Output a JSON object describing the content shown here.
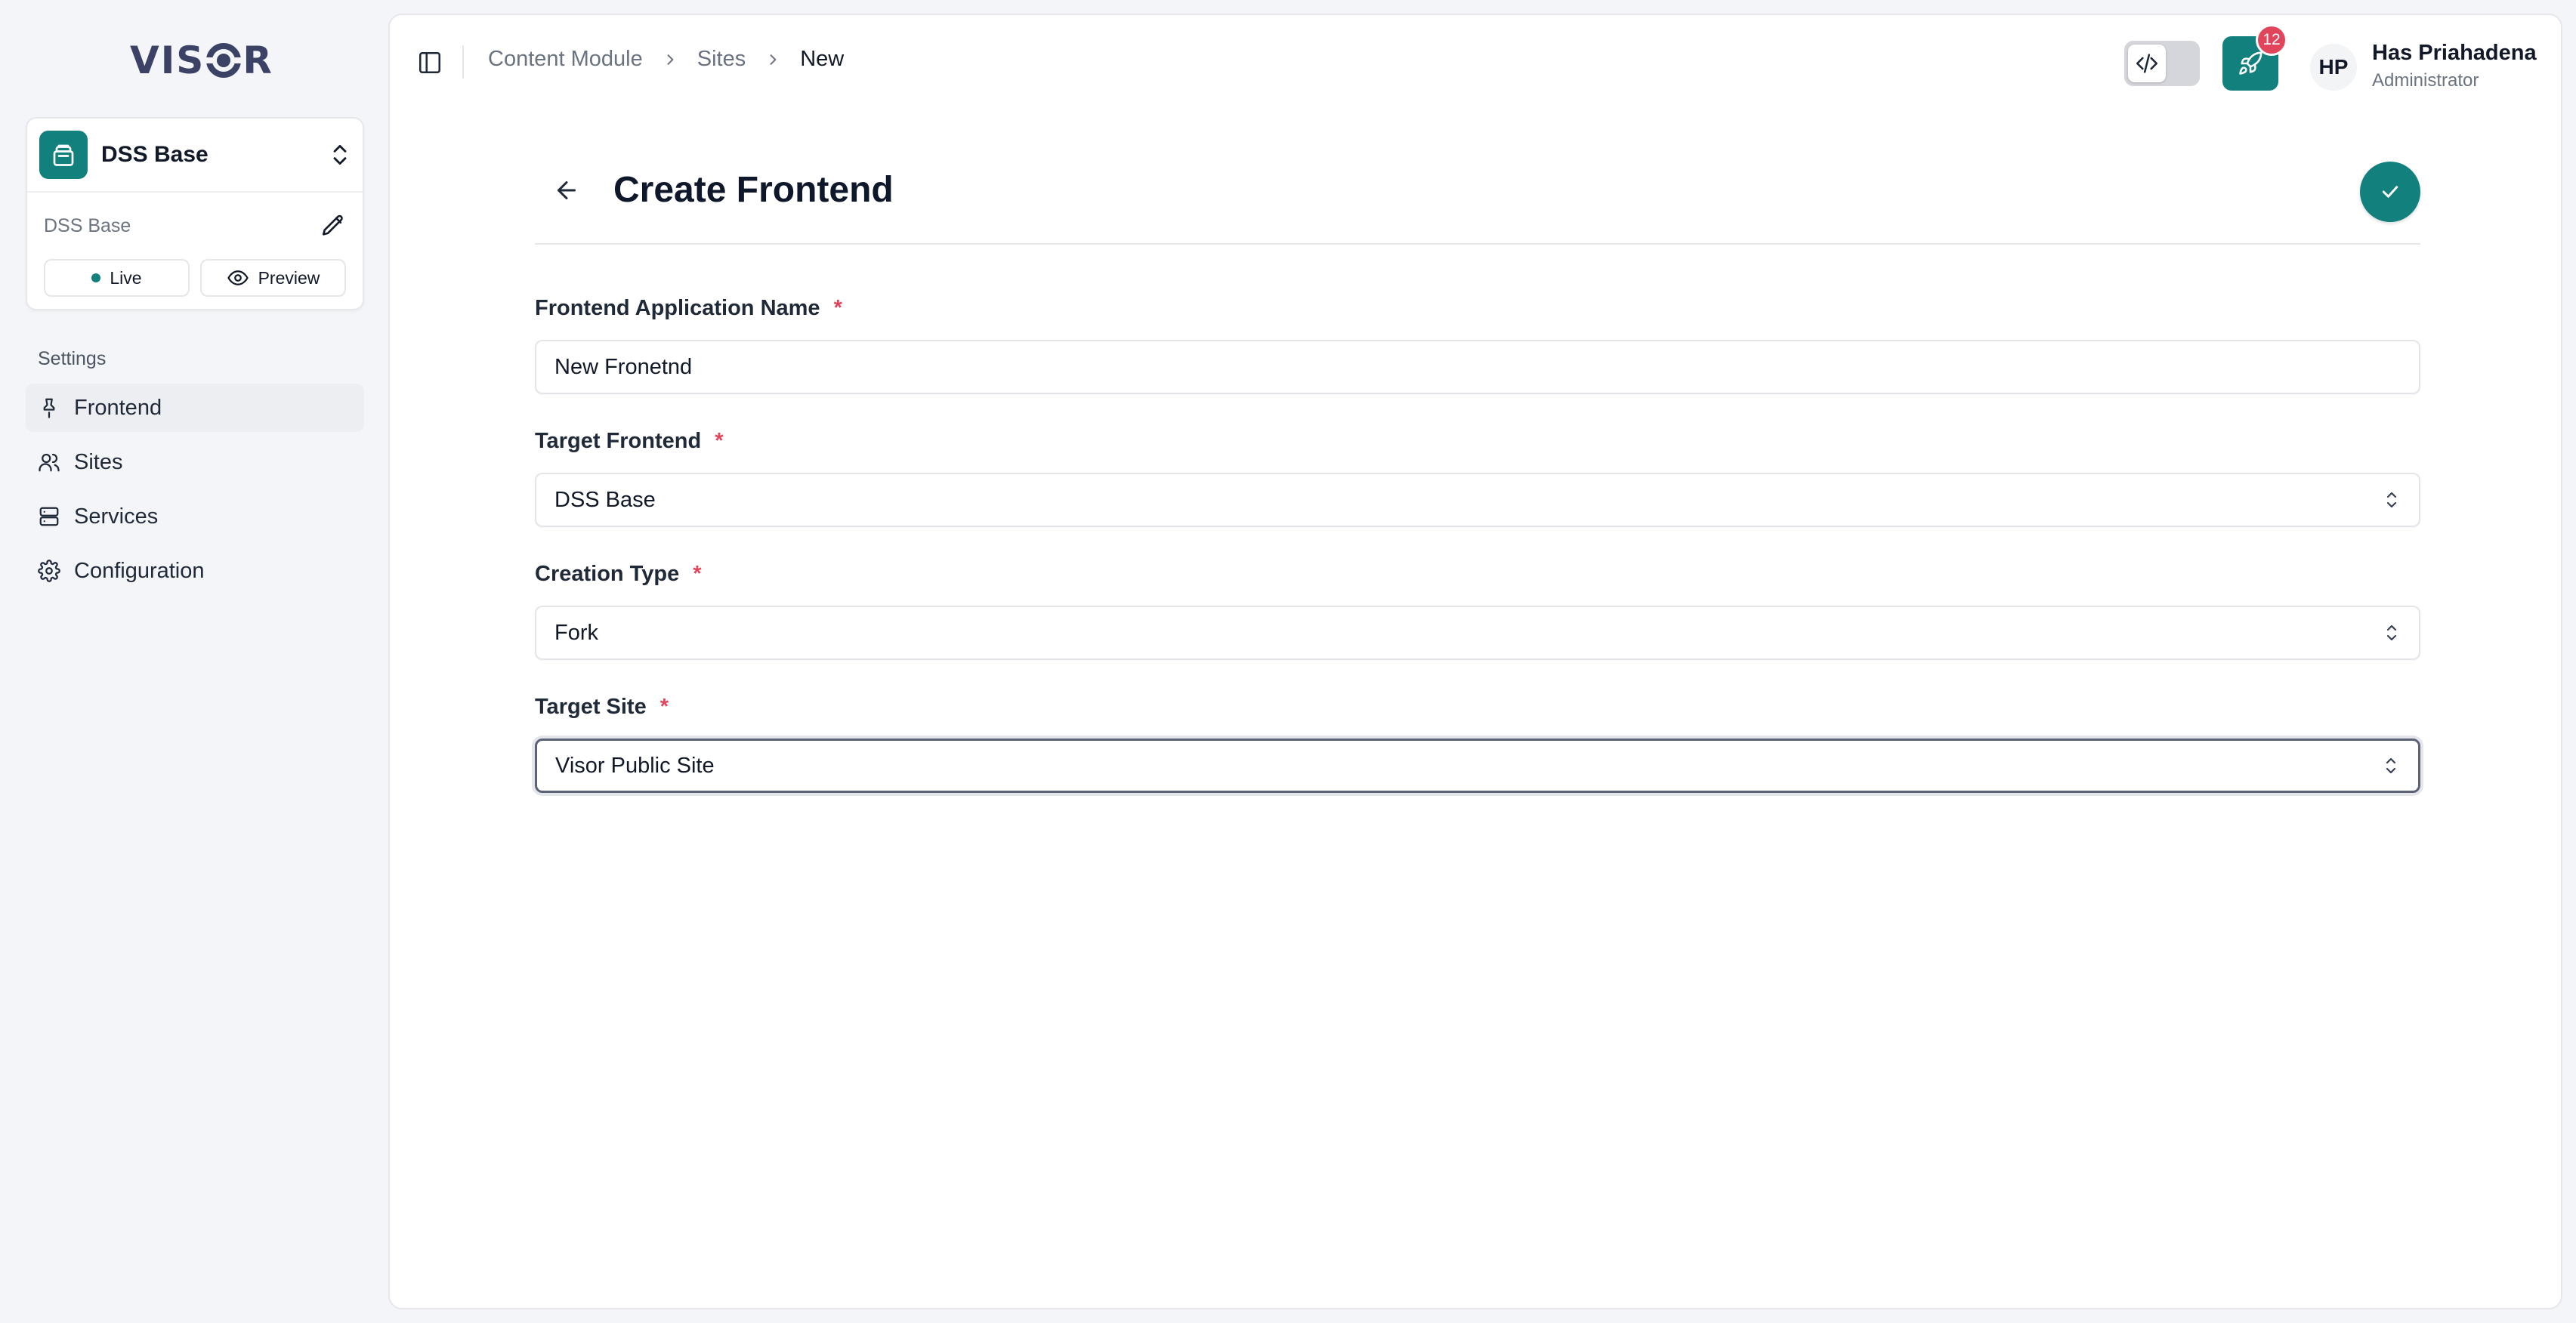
{
  "brand": {
    "logo_text_left": "VIS",
    "logo_text_right": "R"
  },
  "site_switcher": {
    "name": "DSS Base",
    "subtitle": "DSS Base",
    "live_label": "Live",
    "preview_label": "Preview"
  },
  "sidebar": {
    "section_label": "Settings",
    "items": [
      {
        "label": "Frontend",
        "icon": "pin-icon",
        "active": true
      },
      {
        "label": "Sites",
        "icon": "users-icon",
        "active": false
      },
      {
        "label": "Services",
        "icon": "server-icon",
        "active": false
      },
      {
        "label": "Configuration",
        "icon": "gear-icon",
        "active": false
      }
    ]
  },
  "breadcrumb": [
    "Content Module",
    "Sites",
    "New"
  ],
  "topbar": {
    "notification_count": "12",
    "user": {
      "initials": "HP",
      "name": "Has Priahadena",
      "role": "Administrator"
    }
  },
  "page": {
    "title": "Create Frontend"
  },
  "form": {
    "app_name": {
      "label": "Frontend Application Name",
      "required": "*",
      "value": "New Fronetnd"
    },
    "target_frontend": {
      "label": "Target Frontend",
      "required": "*",
      "value": "DSS Base"
    },
    "creation_type": {
      "label": "Creation Type",
      "required": "*",
      "value": "Fork"
    },
    "target_site": {
      "label": "Target Site",
      "required": "*",
      "value": "Visor Public Site"
    }
  },
  "colors": {
    "accent": "#12807c",
    "badge": "#e1455b",
    "brand_text": "#3b4266"
  }
}
